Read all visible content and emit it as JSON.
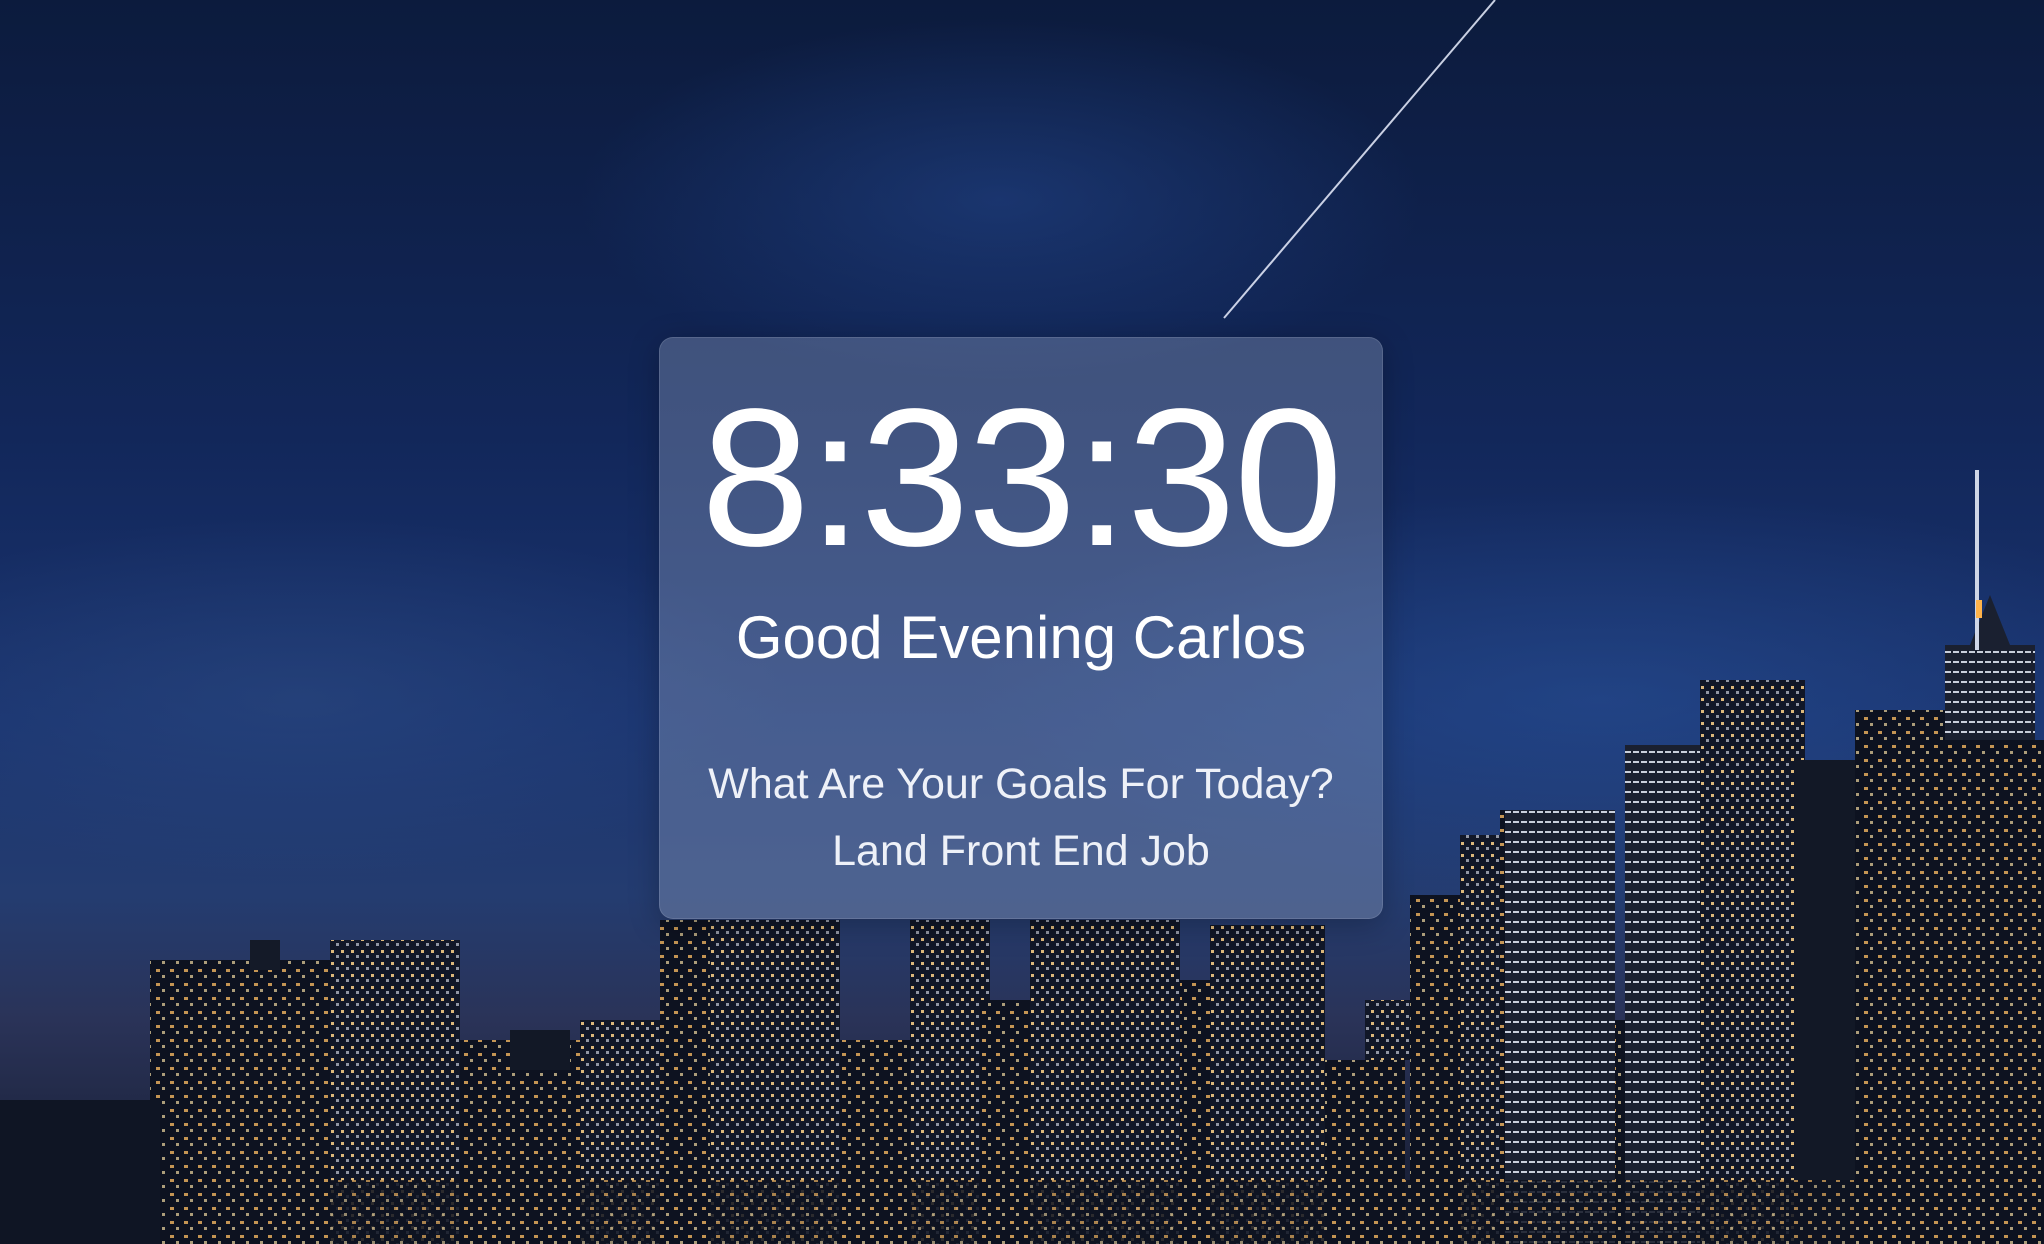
{
  "clock": {
    "time": "8:33:30"
  },
  "greeting": {
    "text": "Good Evening Carlos"
  },
  "focus": {
    "question": "What Are Your Goals For Today?",
    "value": "Land Front End Job"
  },
  "background": {
    "description_icon": "night-city-skyline-image",
    "sky_color": "#12275a",
    "card_tint": "#a5b4d2"
  }
}
